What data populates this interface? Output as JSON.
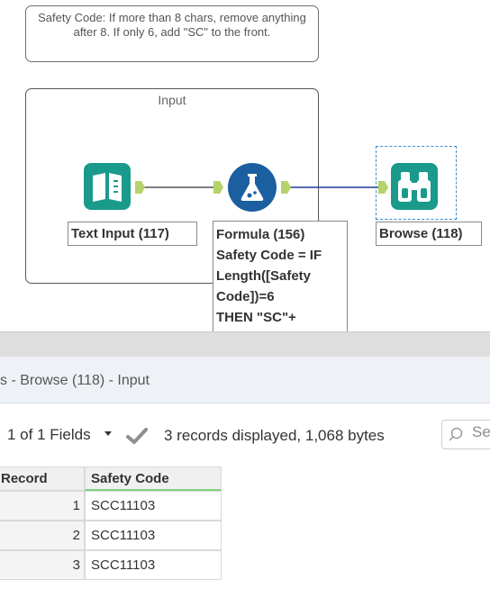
{
  "comment": {
    "text": "Safety Code: If more than 8 chars, remove anything after 8. If only 6, add \"SC\" to the front."
  },
  "container": {
    "title": "Input"
  },
  "tools": {
    "text_input": {
      "label": "Text Input (117)",
      "color": "#1a9a8b"
    },
    "formula": {
      "label": "Formula (156)",
      "color": "#1b5fa0",
      "expression_lines": [
        "Safety Code = IF",
        "Length([Safety",
        "Code])=6",
        "THEN \"SC\"+"
      ]
    },
    "browse": {
      "label": "Browse (118)",
      "color": "#1a9a8b"
    }
  },
  "connection_colors": {
    "first": "#555555",
    "second": "#1f3c9a",
    "anchor": "#b5d36a"
  },
  "results": {
    "title": "s - Browse (118) - Input",
    "fields_selector": "1 of 1 Fields",
    "records_info": "3 records displayed, 1,068 bytes",
    "search_placeholder": "Se",
    "columns": [
      "Record",
      "Safety Code"
    ],
    "rows": [
      {
        "record": "1",
        "safety_code": "SCC11103"
      },
      {
        "record": "2",
        "safety_code": "SCC11103"
      },
      {
        "record": "3",
        "safety_code": "SCC11103"
      }
    ]
  }
}
